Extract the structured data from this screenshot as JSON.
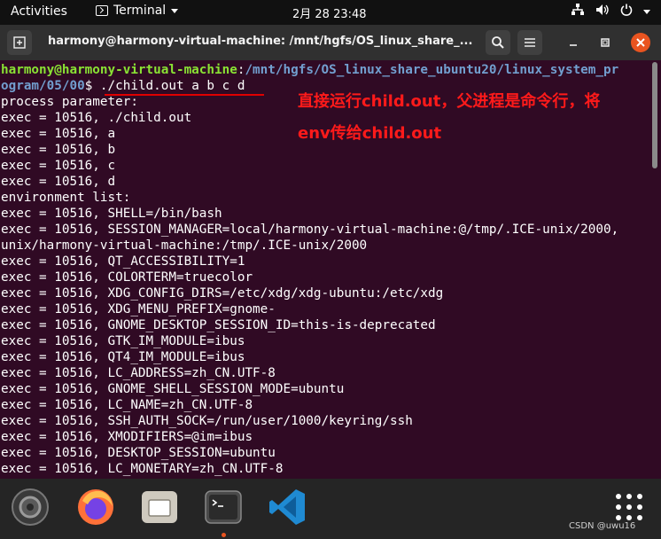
{
  "topbar": {
    "activities": "Activities",
    "app_name": "Terminal",
    "clock": "2月 28  23:48"
  },
  "window": {
    "title": "harmony@harmony-virtual-machine: /mnt/hgfs/OS_linux_share_..."
  },
  "terminal": {
    "prompt_user": "harmony@harmony-virtual-machine",
    "prompt_sep": ":",
    "prompt_path_1": "/mnt/hgfs/OS_linux_share_ubuntu20/linux_system_pr",
    "prompt_path_2": "ogram/05/00",
    "prompt_symbol": "$ ",
    "command": "./child.out a b c d",
    "lines": [
      "process parameter:",
      "exec = 10516, ./child.out",
      "exec = 10516, a",
      "exec = 10516, b",
      "exec = 10516, c",
      "exec = 10516, d",
      "environment list:",
      "exec = 10516, SHELL=/bin/bash",
      "exec = 10516, SESSION_MANAGER=local/harmony-virtual-machine:@/tmp/.ICE-unix/2000,",
      "unix/harmony-virtual-machine:/tmp/.ICE-unix/2000",
      "exec = 10516, QT_ACCESSIBILITY=1",
      "exec = 10516, COLORTERM=truecolor",
      "exec = 10516, XDG_CONFIG_DIRS=/etc/xdg/xdg-ubuntu:/etc/xdg",
      "exec = 10516, XDG_MENU_PREFIX=gnome-",
      "exec = 10516, GNOME_DESKTOP_SESSION_ID=this-is-deprecated",
      "exec = 10516, GTK_IM_MODULE=ibus",
      "exec = 10516, QT4_IM_MODULE=ibus",
      "exec = 10516, LC_ADDRESS=zh_CN.UTF-8",
      "exec = 10516, GNOME_SHELL_SESSION_MODE=ubuntu",
      "exec = 10516, LC_NAME=zh_CN.UTF-8",
      "exec = 10516, SSH_AUTH_SOCK=/run/user/1000/keyring/ssh",
      "exec = 10516, XMODIFIERS=@im=ibus",
      "exec = 10516, DESKTOP_SESSION=ubuntu",
      "exec = 10516, LC_MONETARY=zh_CN.UTF-8"
    ]
  },
  "annotation": {
    "line1": "直接运行child.out，父进程是命令行，将",
    "line2": "env传给child.out"
  },
  "dock": {
    "items": [
      {
        "name": "software-updater-icon"
      },
      {
        "name": "firefox-icon"
      },
      {
        "name": "files-icon"
      },
      {
        "name": "terminal-icon"
      },
      {
        "name": "vscode-icon"
      },
      {
        "name": "show-apps-icon"
      }
    ]
  },
  "watermark": "CSDN @uwu16",
  "colors": {
    "terminal_bg": "#300a24",
    "prompt_user": "#8ae234",
    "prompt_path": "#729fcf",
    "annotation": "#ff1a1a",
    "close_button": "#e95420"
  }
}
